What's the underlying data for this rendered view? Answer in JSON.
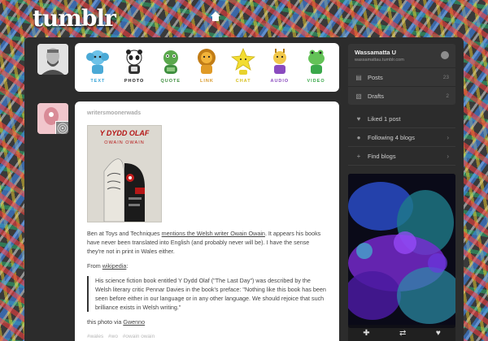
{
  "header": {
    "logo": "tumblr",
    "home_icon": "home-icon"
  },
  "composer": {
    "types": [
      {
        "label": "Text",
        "color": "#3aa6d8",
        "icon": "elephant-icon"
      },
      {
        "label": "Photo",
        "color": "#222222",
        "icon": "panda-icon"
      },
      {
        "label": "Quote",
        "color": "#3f8f3f",
        "icon": "turtle-icon"
      },
      {
        "label": "Link",
        "color": "#d89623",
        "icon": "lion-icon"
      },
      {
        "label": "Chat",
        "color": "#e8d22c",
        "icon": "star-icon"
      },
      {
        "label": "Audio",
        "color": "#c49a20",
        "icon": "giraffe-icon"
      },
      {
        "label": "Video",
        "color": "#3aa84a",
        "icon": "frog-icon"
      }
    ]
  },
  "post": {
    "blog_name": "writersmoonerwads",
    "book_title": "Y DYDD OLAF",
    "book_author": "OWAIN OWAIN",
    "para1_pre": "Ben at Toys and Techniques ",
    "para1_link": "mentions the Welsh writer Owain Owain",
    "para1_post": ". It appears his books have never been translated into English (and probably never will be). I have the sense they're not in print in Wales either.",
    "from_pre": "From ",
    "from_link": "wikipedia",
    "from_post": ":",
    "quote": "His science fiction book entitled Y Dydd Olaf (\"The Last Day\") was described by the Welsh literary critic Pennar Davies in the book's preface: \"Nothing like this book has been seen before either in our language or in any other language. We should rejoice that such brilliance exists in Welsh writing.\"",
    "via_pre": "this photo via ",
    "via_link": "Gwenno",
    "tags": [
      "#wales",
      "#wo",
      "#owain owain"
    ]
  },
  "sidebar": {
    "account_name": "Wassamatta U",
    "account_url": "wassamattau.tumblr.com",
    "posts_label": "Posts",
    "posts_count": "23",
    "drafts_label": "Drafts",
    "drafts_count": "2",
    "liked_label": "Liked 1 post",
    "following_label": "Following 4 blogs",
    "find_label": "Find blogs"
  },
  "colors": {
    "dashboard_bg": "#2c2c2c",
    "card_bg": "#ffffff",
    "sidebar_box": "#363636"
  }
}
